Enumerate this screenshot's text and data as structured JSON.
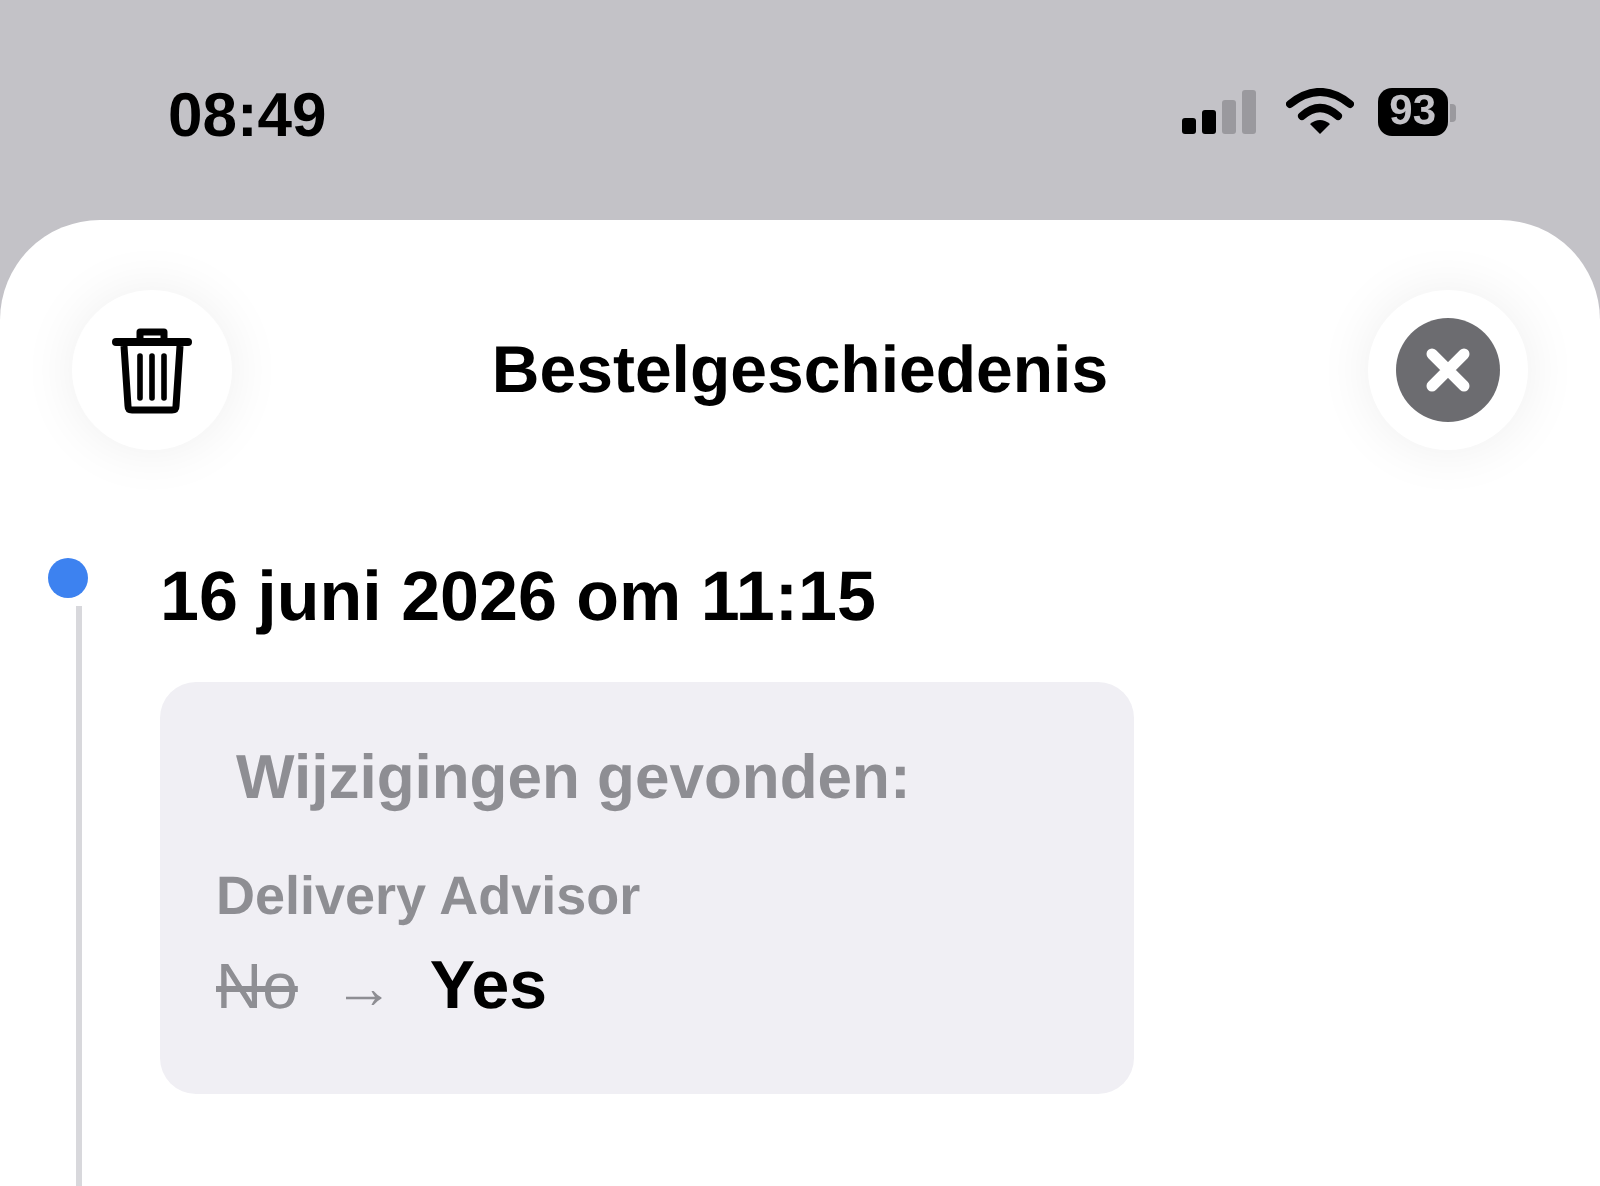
{
  "status_bar": {
    "time": "08:49",
    "battery": "93"
  },
  "header": {
    "title": "Bestelgeschiedenis"
  },
  "history": [
    {
      "date": "16 juni 2026 om 11:15",
      "card_title": "Wijzigingen gevonden:",
      "changes": [
        {
          "field": "Delivery Advisor",
          "old": "No",
          "arrow": "→",
          "new": "Yes"
        }
      ]
    }
  ]
}
